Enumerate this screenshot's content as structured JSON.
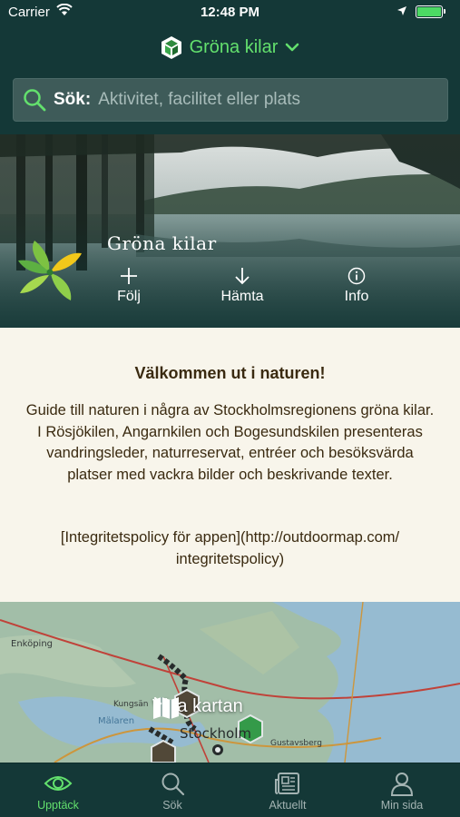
{
  "status_bar": {
    "carrier": "Carrier",
    "time": "12:48 PM",
    "icons": [
      "wifi-icon",
      "location-arrow-icon",
      "battery-icon"
    ]
  },
  "area_selector": {
    "name": "Gröna kilar",
    "icon": "hexagon-logo-icon",
    "chevron": "chevron-down-icon"
  },
  "search": {
    "label": "Sök:",
    "placeholder": "Aktivitet, facilitet eller plats"
  },
  "hero": {
    "title": "Gröna kilar",
    "actions": [
      {
        "label": "Följ",
        "icon": "plus-icon"
      },
      {
        "label": "Hämta",
        "icon": "download-arrow-icon"
      },
      {
        "label": "Info",
        "icon": "info-icon"
      }
    ]
  },
  "welcome": {
    "heading": "Välkommen ut i naturen!",
    "body": "Guide till naturen i några av Stockholmsregionens gröna kilar. I Rösjökilen, Angarnkilen och Bogesundskilen presenteras vandringsleder, naturreservat, entréer och besöksvärda platser med vackra bilder och beskrivande texter.",
    "policy": "[Integritetspolicy för appen](http://outdoormap.com/ integritetspolicy)"
  },
  "map": {
    "cta_label": "Visa kartan",
    "place_labels": [
      "Enköping",
      "Kungsän",
      "Mälaren",
      "Stockholm",
      "Gustavsberg"
    ]
  },
  "tabs": [
    {
      "label": "Upptäck",
      "icon": "eye-icon",
      "active": true
    },
    {
      "label": "Sök",
      "icon": "search-icon",
      "active": false
    },
    {
      "label": "Aktuellt",
      "icon": "newspaper-icon",
      "active": false
    },
    {
      "label": "Min sida",
      "icon": "person-icon",
      "active": false
    }
  ],
  "colors": {
    "background": "#143837",
    "accent": "#63e06d",
    "search_bg": "#3e5b59",
    "content_bg": "#f8f5eb",
    "text_dark": "#3a2a10"
  }
}
